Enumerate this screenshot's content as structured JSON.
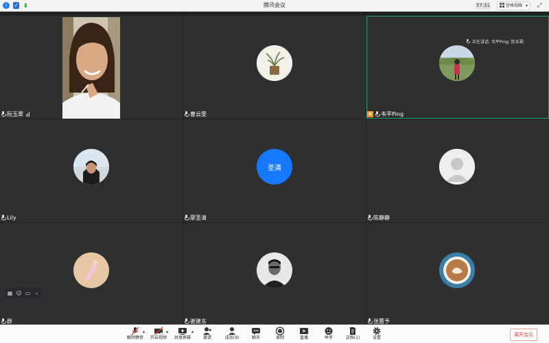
{
  "window": {
    "title": "腾讯会议",
    "timer": "57:31",
    "view_label": "宫格视图"
  },
  "speaking": {
    "text": "正在讲话: 韦平Ping; 阮玉翠;"
  },
  "participants": [
    {
      "name": "阮玉翠",
      "video": true,
      "signal": true
    },
    {
      "name": "曹云雯",
      "avatar": "plant-photo"
    },
    {
      "name": "韦平Ping",
      "avatar": "outdoor-photo",
      "host": true,
      "active": true
    },
    {
      "name": "Lily",
      "avatar": "beach-photo"
    },
    {
      "name": "廖圣清",
      "avatar_text": "圣清",
      "avatar_color": "#1677ff"
    },
    {
      "name": "陈静静",
      "avatar": "default-person"
    },
    {
      "name": "群",
      "avatar": "sand-photo"
    },
    {
      "name": "谢建东",
      "avatar": "bw-portrait"
    },
    {
      "name": "张蕙予",
      "avatar": "coffee-photo"
    }
  ],
  "toolbar": {
    "mute": "解除静音",
    "video": "开启视频",
    "share": "共享屏幕",
    "invite": "邀请",
    "members": "成员(9)",
    "chat": "聊天",
    "record": "录制",
    "live": "直播",
    "reactions": "举手",
    "docs": "文档(1)",
    "settings": "设置",
    "leave": "离开会议"
  },
  "colors": {
    "accent": "#1677ff",
    "tile_bg": "#2e2f31",
    "active_border": "#1fa36a",
    "leave_red": "#e33b3b"
  }
}
